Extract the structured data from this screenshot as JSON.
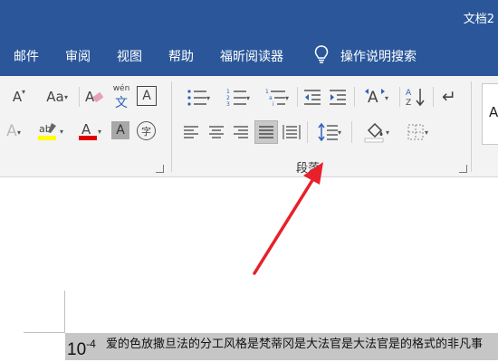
{
  "window": {
    "title": "文档2"
  },
  "menu": {
    "tabs": [
      "邮件",
      "审阅",
      "视图",
      "帮助",
      "福昕阅读器"
    ],
    "tell_me": "操作说明搜索"
  },
  "ribbon": {
    "font_group": {
      "phonetic_guide_top": "wén",
      "phonetic_guide_bottom": "文",
      "char_border": "A",
      "enclose_char": "字"
    },
    "paragraph_group": {
      "label": "段落"
    },
    "styles_preview": "A"
  },
  "document": {
    "base": "10",
    "exponent": "-4",
    "text": "爱的色放撒旦法的分工风格是梵蒂冈是大法官是大法官是的格式的非凡事"
  },
  "colors": {
    "title_bar": "#2b579a",
    "highlight": "#ffff00",
    "font_color": "#e00000",
    "arrow": "#e8202a"
  }
}
